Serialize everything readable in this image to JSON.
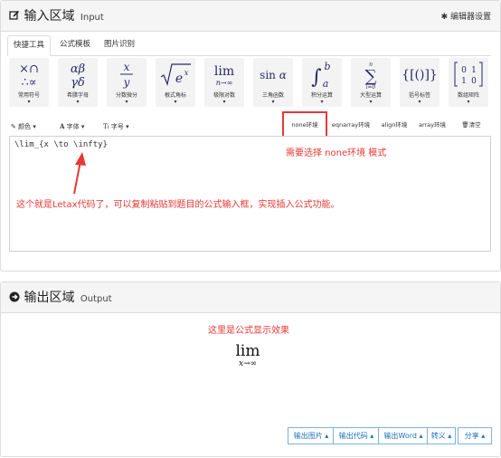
{
  "input_panel": {
    "title": "输入区域",
    "title_en": "Input",
    "settings": "编辑器设置"
  },
  "tabs": [
    "快捷工具",
    "公式模板",
    "图片识别"
  ],
  "tools": [
    {
      "symbol": "×∩ ∴∝",
      "label": "常用符号"
    },
    {
      "symbol": "αβ γδ",
      "label": "希腊字母"
    },
    {
      "symbol": "x/y",
      "label": "分数微分"
    },
    {
      "symbol": "√e^x",
      "label": "根式角标"
    },
    {
      "symbol": "lim n→∞",
      "label": "极限对数"
    },
    {
      "symbol": "sin α",
      "label": "三角函数"
    },
    {
      "symbol": "∫_a^b",
      "label": "积分运算"
    },
    {
      "symbol": "∑_{i=0}^n",
      "label": "大型运算"
    },
    {
      "symbol": "{[()]}",
      "label": "括号标签"
    },
    {
      "symbol": "[0 1; 1 0]",
      "label": "数组矩阵"
    }
  ],
  "format_bar": {
    "color": "颜色",
    "font": "字体",
    "size": "字号"
  },
  "env_buttons": [
    "none环境",
    "eqnarray环境",
    "align环境",
    "array环境"
  ],
  "clear_label": "清空",
  "editor": {
    "code": "\\lim_{x \\to \\infty}"
  },
  "annotations": {
    "env_note": "需要选择 none环境 模式",
    "code_note": "这个就是Letax代码了，可以复制粘贴到题目的公式输入框，实现插入公式功能。",
    "output_note": "这里是公式显示效果"
  },
  "output_panel": {
    "title": "输出区域",
    "title_en": "Output",
    "formula_main": "lim",
    "formula_sub": "x→∞"
  },
  "output_buttons": [
    "输出图片",
    "输出代码",
    "输出Word",
    "转义",
    "分享"
  ],
  "colors": {
    "accent_red": "#e53935",
    "button_blue": "#1e6fb8",
    "symbol_navy": "#2a2a6a"
  }
}
